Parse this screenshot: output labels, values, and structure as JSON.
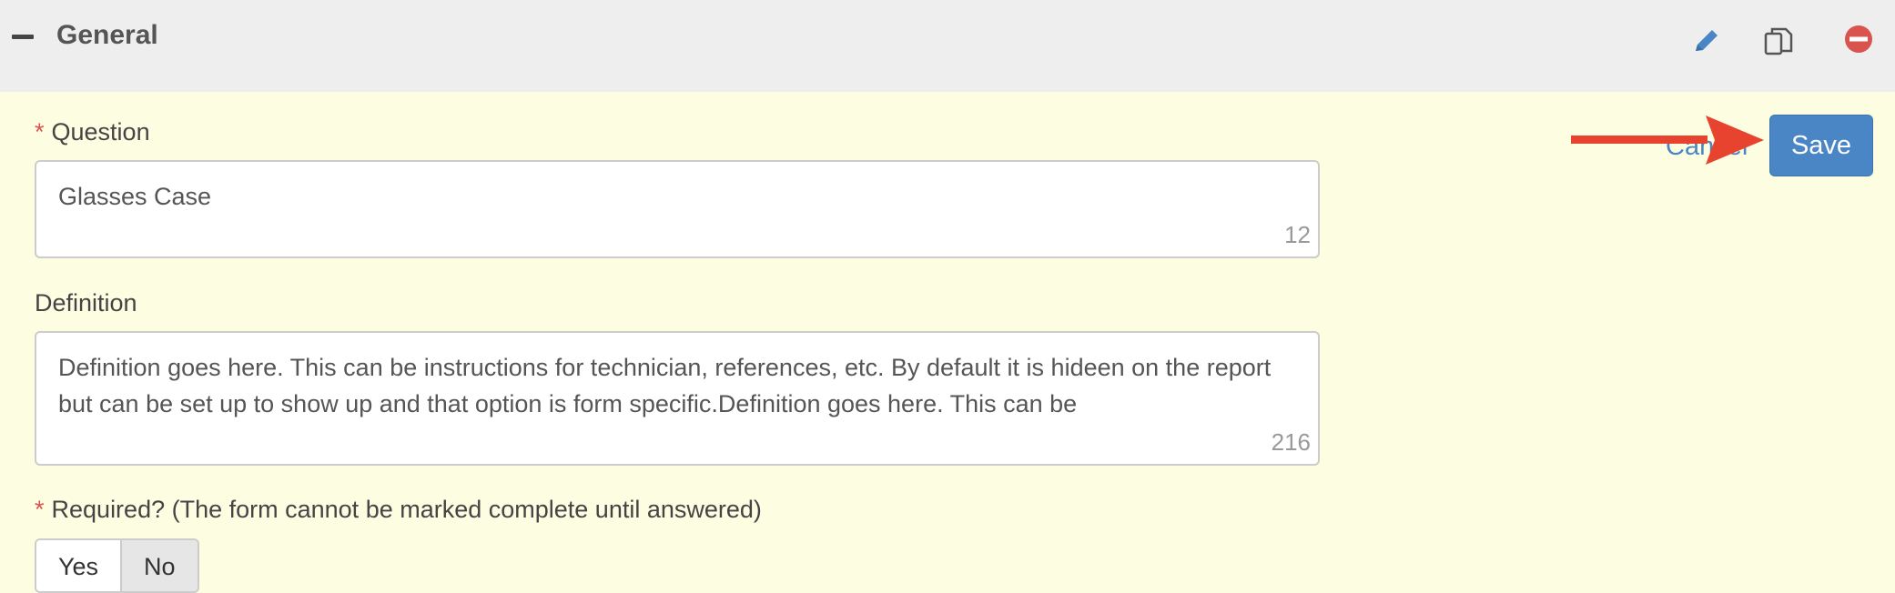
{
  "header": {
    "title": "General",
    "icons": [
      "minus-icon",
      "pencil-icon",
      "copy-icon",
      "remove-circle-icon"
    ]
  },
  "question": {
    "required_mark": "*",
    "label": "Question",
    "value": "Glasses Case",
    "count": "12"
  },
  "definition": {
    "label": "Definition",
    "value": "Definition goes here.  This can be instructions for technician, references, etc.  By default it is hideen on the report but can be set up to show up and that option is form specific.Definition goes here.  This can be",
    "count": "216"
  },
  "required": {
    "required_mark": "*",
    "label": "Required? (The form cannot be marked complete until answered)",
    "options": [
      "Yes",
      "No"
    ],
    "selected": "No"
  },
  "actions": {
    "cancel_label": "Cancel",
    "save_label": "Save"
  },
  "colors": {
    "accent": "#4a86c5",
    "background": "#fdfde2",
    "header": "#eeeeee",
    "arrow": "#e8432e",
    "required": "#d9534f"
  }
}
